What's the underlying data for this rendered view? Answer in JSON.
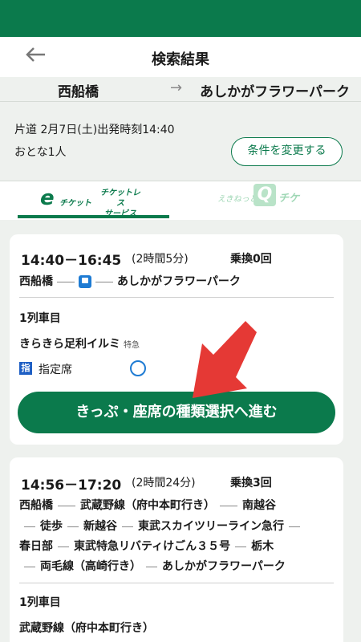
{
  "header": {
    "back_icon": "arrow-left-icon",
    "title": "検索結果"
  },
  "route": {
    "from": "西船橋",
    "arrow": "→",
    "to": "あしかがフラワーパーク"
  },
  "search_info": {
    "line1": "片道 2月7日(土)出発時刻14:40",
    "line2": "おとな1人",
    "change_button": "条件を変更する"
  },
  "tabs": {
    "tab1": {
      "e_mark": "e",
      "brand": "チケット",
      "sub1": "チケットレス",
      "sub2": "サービス",
      "selected": true
    },
    "tab2": {
      "prefix": "えきねっと",
      "q_mark": "Q",
      "suffix": "チケ",
      "selected": false
    }
  },
  "results": [
    {
      "time": "14:40－16:45",
      "duration": "(2時間5分)",
      "transfers": "乗換0回",
      "route_from": "西船橋",
      "route_to": "あしかがフラワーパーク",
      "section_label": "1列車目",
      "train_name": "きらきら足利イルミ",
      "train_kind": "特急",
      "seat_badge": "指",
      "seat_label": "指定席",
      "proceed_button": "きっぷ・座席の種類選択へ進む"
    },
    {
      "time": "14:56－17:20",
      "duration": "(2時間24分)",
      "transfers": "乗換3回",
      "route_segments": [
        "西船橋",
        "武蔵野線（府中本町行き）",
        "南越谷",
        "徒歩",
        "新越谷",
        "東武スカイツリーライン急行",
        "春日部",
        "東武特急リバティけごん３５号",
        "栃木",
        "両毛線（高崎行き）",
        "あしかがフラワーパーク"
      ],
      "section_label": "1列車目",
      "train_name": "武蔵野線（府中本町行き）"
    }
  ],
  "colors": {
    "brand_green": "#0b7a4c",
    "accent_blue": "#1e7bd3",
    "annotation_red": "#e53935"
  }
}
